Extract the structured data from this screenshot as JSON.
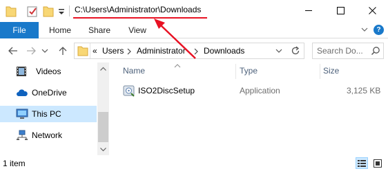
{
  "title_bar": {
    "path": "C:\\Users\\Administrator\\Downloads",
    "underline_color": "#e81123",
    "buttons": [
      "minimize-icon",
      "maximize-icon",
      "close-icon"
    ]
  },
  "ribbon": {
    "tabs": [
      {
        "label": "File"
      },
      {
        "label": "Home"
      },
      {
        "label": "Share"
      },
      {
        "label": "View"
      }
    ],
    "accent": "#1979ca",
    "help": "?"
  },
  "address": {
    "overflow": "«",
    "crumbs": [
      "Users",
      "Administrator",
      "Downloads"
    ]
  },
  "search": {
    "placeholder": "Search Do..."
  },
  "nav_pane": {
    "items": [
      {
        "label": "Videos",
        "icon": "video-folder-icon"
      },
      {
        "label": "OneDrive",
        "icon": "onedrive-cloud-icon"
      },
      {
        "label": "This PC",
        "icon": "monitor-icon",
        "selected": true
      },
      {
        "label": "Network",
        "icon": "network-icon"
      }
    ]
  },
  "columns": {
    "name": "Name",
    "type": "Type",
    "size": "Size"
  },
  "files": [
    {
      "name": "ISO2DiscSetup",
      "type": "Application",
      "size": "3,125 KB",
      "icon": "installer-icon"
    }
  ],
  "status": {
    "count": "1 item"
  },
  "annotation": {
    "arrow_color": "#e81123"
  }
}
